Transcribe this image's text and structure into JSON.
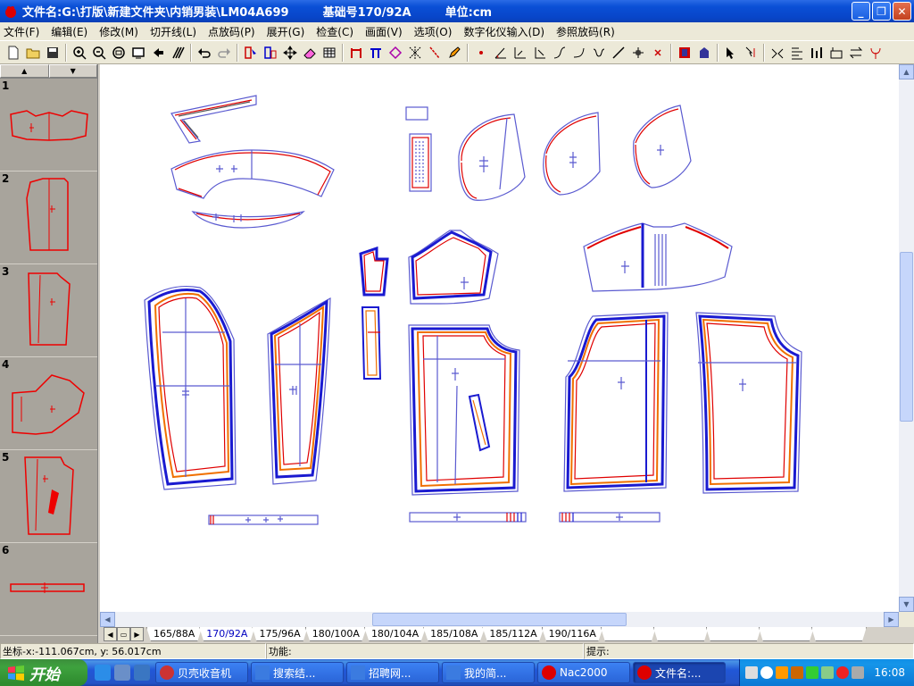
{
  "window": {
    "title_file": "文件名:G:\\打版\\新建文件夹\\内销男装\\LM04A699",
    "title_base": "基础号170/92A",
    "title_unit": "单位:cm",
    "controls": [
      "minimize",
      "restore",
      "close"
    ]
  },
  "menu": [
    "文件(F)",
    "编辑(E)",
    "修改(M)",
    "切开线(L)",
    "点放码(P)",
    "展开(G)",
    "检查(C)",
    "画面(V)",
    "选项(O)",
    "数字化仪输入(D)",
    "参照放码(R)"
  ],
  "toolbar_icons": [
    "new-file-icon",
    "open-folder-icon",
    "save-icon",
    "zoom-in-icon",
    "zoom-out-icon",
    "zoom-fit-icon",
    "screen-icon",
    "arrow-left-icon",
    "stripes-icon",
    "undo-icon",
    "redo-icon",
    "piece-select-icon",
    "piece-copy-icon",
    "move-icon",
    "eraser-icon",
    "table-icon",
    "bracket-icon",
    "pi-icon",
    "diamond-icon",
    "cross-pattern-icon",
    "slash-icon",
    "pen-icon",
    "dot-icon",
    "angle-measure-icon",
    "ruler-icon",
    "corner-icon",
    "curve-up-icon",
    "curve-down-icon",
    "bezier-icon",
    "line-icon",
    "node-icon",
    "x-mark-icon",
    "fill-piece-icon",
    "hanger-icon",
    "cursor-icon",
    "split-cursor-icon",
    "mirror-icon",
    "align-icon",
    "grade-icon",
    "rect-icon",
    "swap-icon",
    "hook-icon"
  ],
  "thumbnails": [
    {
      "num": "1"
    },
    {
      "num": "2"
    },
    {
      "num": "3"
    },
    {
      "num": "4"
    },
    {
      "num": "5"
    },
    {
      "num": "6"
    }
  ],
  "size_tabs": [
    "165/88A",
    "170/92A",
    "175/96A",
    "180/100A",
    "180/104A",
    "185/108A",
    "185/112A",
    "190/116A"
  ],
  "active_size": "170/92A",
  "status": {
    "coords": "坐标-x:-111.067cm, y:  56.017cm",
    "function_label": "功能:",
    "hint_label": "提示:"
  },
  "taskbar": {
    "start_label": "开始",
    "tasks": [
      "贝壳收音机",
      "搜索结...",
      "招聘网...",
      "我的简...",
      "Nac2000",
      "文件名:..."
    ],
    "active_task": "文件名:...",
    "clock": "16:08"
  },
  "colors": {
    "titlebar": "#0a4fd6",
    "pattern_base": "#e00000",
    "pattern_grade_blue": "#1a1ad0",
    "pattern_grade_orange": "#f07000",
    "pattern_grade_purple": "#8a3ab8",
    "canvas_bg": "#ffffff"
  }
}
